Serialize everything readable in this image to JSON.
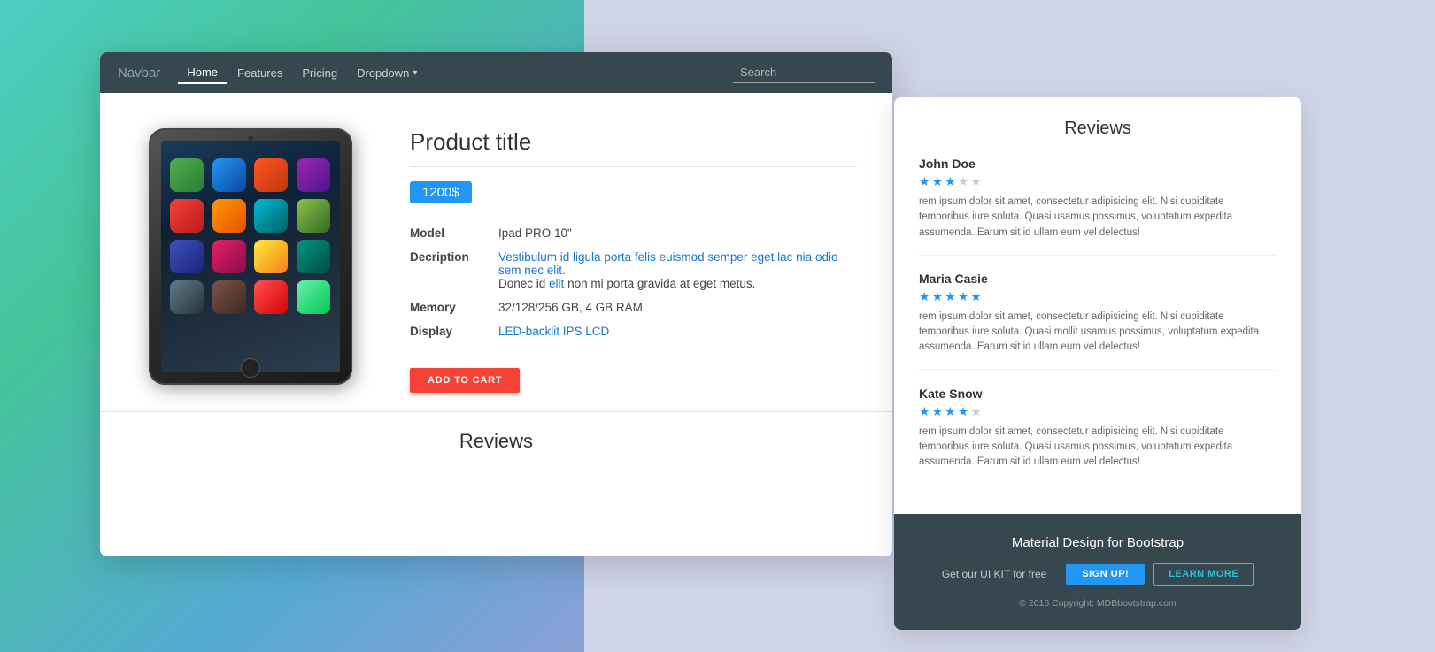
{
  "background": {
    "left_color": "#4ecdc4",
    "right_color": "#d0d4e8"
  },
  "navbar": {
    "brand": "Navbar",
    "links": [
      {
        "label": "Home",
        "active": true
      },
      {
        "label": "Features",
        "active": false
      },
      {
        "label": "Pricing",
        "active": false
      }
    ],
    "dropdown_label": "Dropdown",
    "search_placeholder": "Search"
  },
  "product": {
    "title": "Product title",
    "price": "1200$",
    "specs": [
      {
        "label": "Model",
        "value": "Ipad PRO 10\""
      },
      {
        "label": "Decription",
        "value_parts": [
          {
            "text": "Vestibulum id ligula porta felis euismod semper eget lac nia odio sem nec elit.",
            "link": true
          },
          {
            "text": "Donec id elit non mi porta gravida at eget metus.",
            "link_partial": true
          }
        ]
      },
      {
        "label": "Memory",
        "value": "32/128/256 GB, 4 GB RAM"
      },
      {
        "label": "Display",
        "value": "LED-backlit IPS LCD"
      }
    ],
    "add_to_cart_label": "ADD TO CART"
  },
  "reviews_section": {
    "title": "Reviews"
  },
  "back_card": {
    "reviews_title": "Reviews",
    "reviews": [
      {
        "name": "John Doe",
        "stars": 3,
        "text": "rem ipsum dolor sit amet, consectetur adipisicing elit. Nisi cupiditate temporibus iure soluta. Quasi usamus possimus, voluptatum expedita assumenda. Earum sit id ullam eum vel delectus!"
      },
      {
        "name": "Maria Casie",
        "stars": 5,
        "text": "rem ipsum dolor sit amet, consectetur adipisicing elit. Nisi cupiditate temporibus iure soluta. Quasi mollit usamus possimus, voluptatum expedita assumenda. Earum sit id ullam eum vel delectus!"
      },
      {
        "name": "Kate Snow",
        "stars": 4,
        "text": "rem ipsum dolor sit amet, consectetur adipisicing elit. Nisi cupiditate temporibus iure soluta. Quasi usamus possimus, voluptatum expedita assumenda. Earum sit id ullam eum vel delectus!"
      }
    ],
    "footer": {
      "title": "Material Design for Bootstrap",
      "cta_text": "Get our UI KIT for free",
      "signup_label": "SIGN UP!",
      "learn_label": "LEARN MORE",
      "copyright": "© 2015 Copyright: MDBbootstrap.com"
    }
  },
  "icons": {
    "star_filled": "★",
    "star_empty": "★",
    "dropdown_arrow": "▾"
  }
}
